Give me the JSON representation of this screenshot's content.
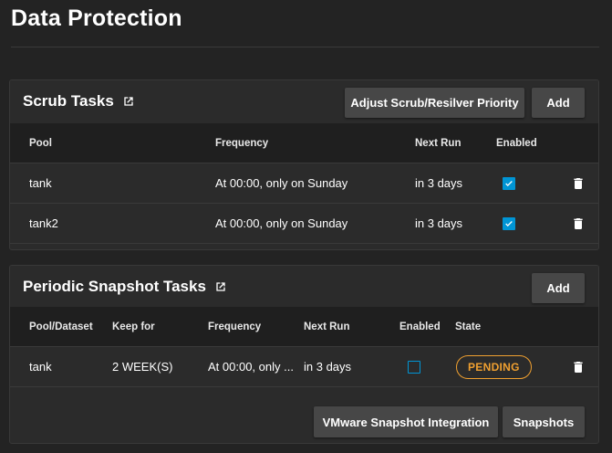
{
  "page": {
    "title": "Data Protection"
  },
  "scrub": {
    "title": "Scrub Tasks",
    "adjust_label": "Adjust Scrub/Resilver Priority",
    "add_label": "Add",
    "columns": [
      "Pool",
      "Frequency",
      "Next Run",
      "Enabled"
    ],
    "rows": [
      {
        "pool": "tank",
        "frequency": "At 00:00, only on Sunday",
        "next_run": "in 3 days",
        "enabled": true
      },
      {
        "pool": "tank2",
        "frequency": "At 00:00, only on Sunday",
        "next_run": "in 3 days",
        "enabled": true
      }
    ]
  },
  "snapshot": {
    "title": "Periodic Snapshot Tasks",
    "add_label": "Add",
    "columns": [
      "Pool/Dataset",
      "Keep for",
      "Frequency",
      "Next Run",
      "Enabled",
      "State"
    ],
    "rows": [
      {
        "dataset": "tank",
        "keep_for": "2 WEEK(S)",
        "frequency": "At 00:00, only ...",
        "next_run": "in 3 days",
        "enabled": false,
        "state": "PENDING"
      }
    ],
    "vmware_label": "VMware Snapshot Integration",
    "snapshots_label": "Snapshots"
  },
  "icons": {
    "external": "open-in-new-icon",
    "delete": "trash-icon",
    "check": "check-icon"
  },
  "colors": {
    "accent": "#0095d5",
    "pending": "#f0a030",
    "background": "#232323",
    "card": "#2b2b2b"
  }
}
